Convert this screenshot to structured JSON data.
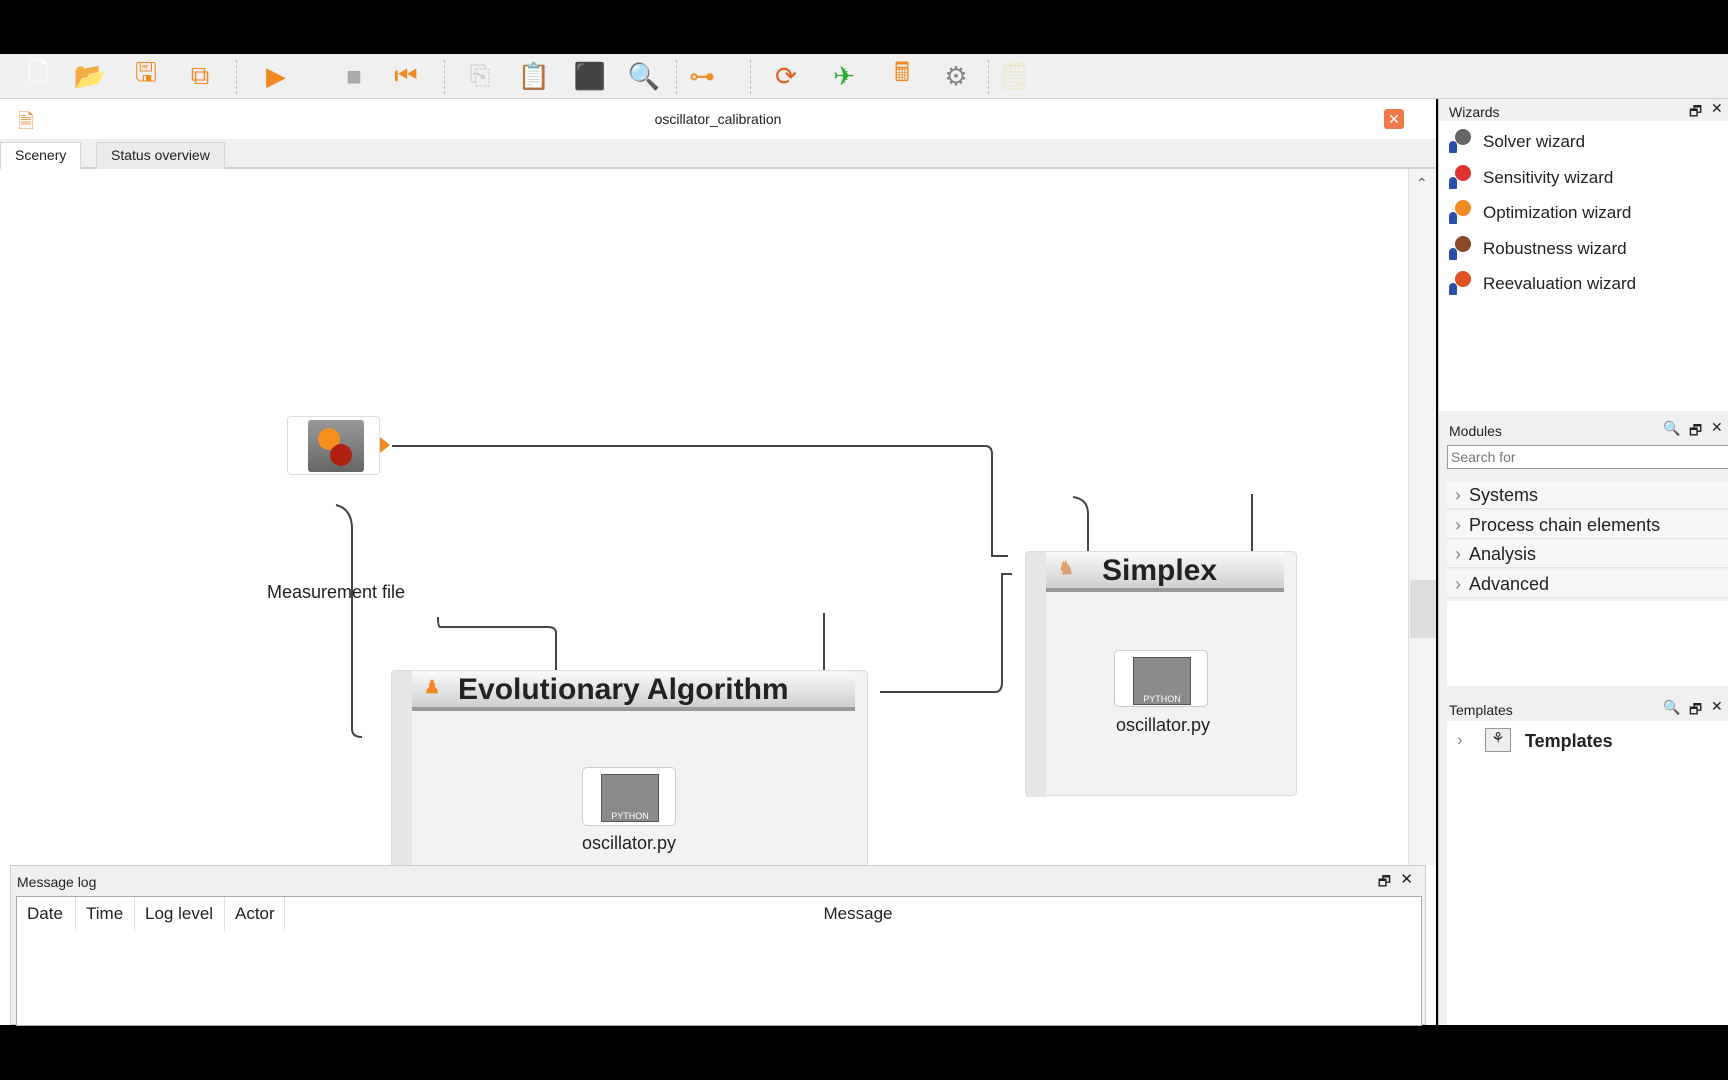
{
  "toolbar": {
    "buttons": [
      {
        "name": "new-file-icon",
        "glyph": "🗋"
      },
      {
        "name": "open-folder-icon",
        "glyph": "📂"
      },
      {
        "name": "save-icon",
        "glyph": "🖫"
      },
      {
        "name": "save-all-icon",
        "glyph": "⧉"
      },
      {
        "name": "run-icon",
        "glyph": "▶"
      },
      {
        "name": "stop-icon",
        "glyph": "■"
      },
      {
        "name": "reset-icon",
        "glyph": "⏮"
      },
      {
        "name": "copy-icon",
        "glyph": "⎘"
      },
      {
        "name": "paste-icon",
        "glyph": "📋"
      },
      {
        "name": "fit-icon",
        "glyph": "⬛"
      },
      {
        "name": "zoom-icon",
        "glyph": "🔍"
      },
      {
        "name": "connect-icon",
        "glyph": "⊶"
      },
      {
        "name": "refresh-icon",
        "glyph": "⟳"
      },
      {
        "name": "aedt-icon",
        "glyph": "✈"
      },
      {
        "name": "calculator-icon",
        "glyph": "🖩"
      },
      {
        "name": "solver-icon",
        "glyph": "⚙"
      },
      {
        "name": "note-icon",
        "glyph": "🗒"
      }
    ]
  },
  "document": {
    "title": "oscillator_calibration",
    "tabs": [
      "Scenery",
      "Status overview"
    ],
    "active_tab": "Scenery"
  },
  "canvas": {
    "measurement": {
      "label": "Measurement file"
    },
    "ea": {
      "title": "Evolutionary Algorithm",
      "python_label": "oscillator.py",
      "python_badge": "PYTHON"
    },
    "simplex": {
      "title": "Simplex",
      "python_label": "oscillator.py",
      "python_badge": "PYTHON"
    }
  },
  "message_log": {
    "title": "Message log",
    "columns": [
      "Date",
      "Time",
      "Log level",
      "Actor",
      "Message"
    ]
  },
  "wizards": {
    "title": "Wizards",
    "items": [
      "Solver wizard",
      "Sensitivity wizard",
      "Optimization wizard",
      "Robustness wizard",
      "Reevaluation wizard"
    ]
  },
  "modules": {
    "title": "Modules",
    "search_placeholder": "Search for",
    "items": [
      "Systems",
      "Process chain elements",
      "Analysis",
      "Advanced"
    ]
  },
  "templates": {
    "title": "Templates",
    "items": [
      "Templates"
    ]
  },
  "colors": {
    "accent": "#f08a24",
    "close": "#f07a4a"
  }
}
